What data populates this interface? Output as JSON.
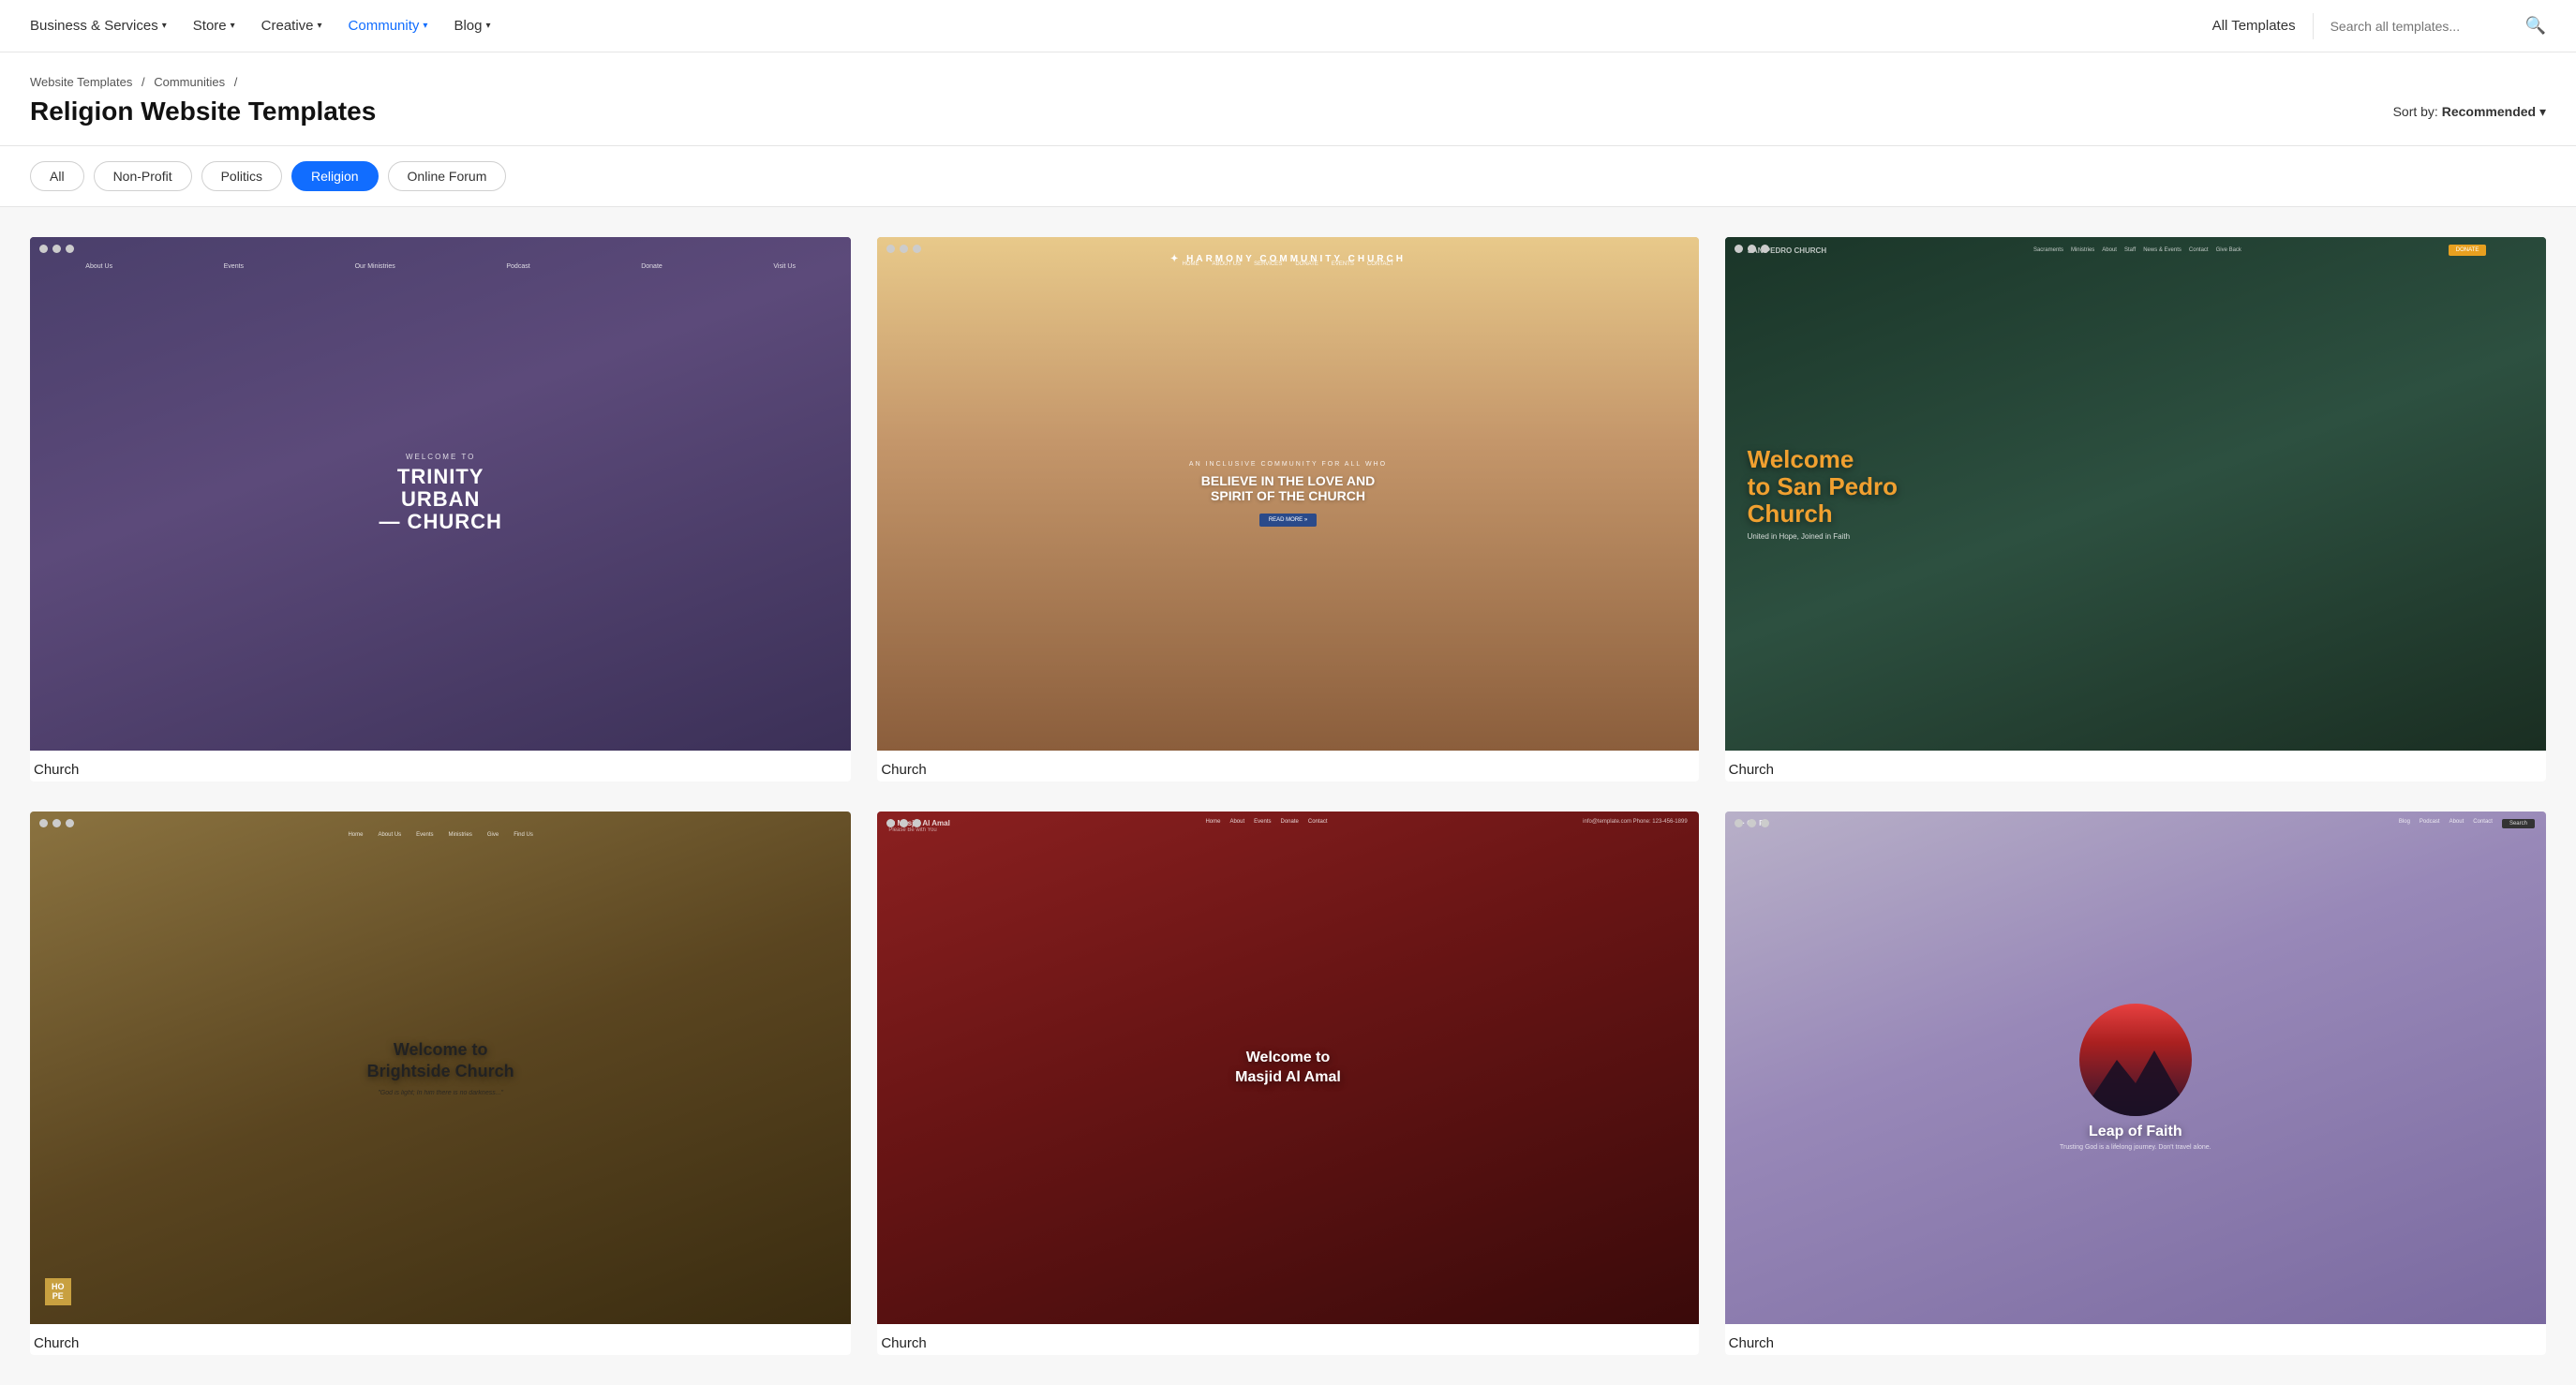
{
  "nav": {
    "items": [
      {
        "id": "business-services",
        "label": "Business & Services",
        "hasDropdown": true,
        "active": false
      },
      {
        "id": "store",
        "label": "Store",
        "hasDropdown": true,
        "active": false
      },
      {
        "id": "creative",
        "label": "Creative",
        "hasDropdown": true,
        "active": false
      },
      {
        "id": "community",
        "label": "Community",
        "hasDropdown": true,
        "active": true
      },
      {
        "id": "blog",
        "label": "Blog",
        "hasDropdown": true,
        "active": false
      }
    ],
    "all_templates": "All Templates",
    "search_placeholder": "Search all templates..."
  },
  "breadcrumb": {
    "parts": [
      "Website Templates",
      "Communities"
    ],
    "separator": "/"
  },
  "page": {
    "title": "Religion Website Templates",
    "sort_label": "Sort by:",
    "sort_value": "Recommended"
  },
  "filters": [
    {
      "id": "all",
      "label": "All",
      "active": false
    },
    {
      "id": "non-profit",
      "label": "Non-Profit",
      "active": false
    },
    {
      "id": "politics",
      "label": "Politics",
      "active": false
    },
    {
      "id": "religion",
      "label": "Religion",
      "active": true
    },
    {
      "id": "online-forum",
      "label": "Online Forum",
      "active": false
    }
  ],
  "templates": [
    {
      "id": "trinity-church",
      "label": "Church",
      "type": "trinity",
      "title": "TRINITY URBAN CHURCH",
      "welcome_text": "WELCOME TO",
      "nav_items": [
        "About Us",
        "Events",
        "Our Ministries",
        "Podcast",
        "Donate",
        "Visit Us"
      ]
    },
    {
      "id": "harmony-church",
      "label": "Church",
      "type": "harmony",
      "logo": "HARMONY COMMUNITY CHURCH",
      "tagline": "AN INCLUSIVE COMMUNITY FOR ALL WHO",
      "title": "BELIEVE IN THE LOVE AND SPIRIT OF THE CHURCH",
      "button": "READ MORE »"
    },
    {
      "id": "sanpedro-church",
      "label": "Church",
      "type": "sanpedro",
      "logo": "SAN PEDRO CHURCH",
      "title": "Welcome to San Pedro Church",
      "subtitle": "United in Hope, Joined in Faith",
      "cta": "DONATE"
    },
    {
      "id": "brightside-church",
      "label": "Church",
      "type": "brightside",
      "title": "Welcome to Brightside Church",
      "quote": "\"God is light; In him there is no darkness...\"",
      "badge": "HO\nPE"
    },
    {
      "id": "masjid-church",
      "label": "Church",
      "type": "masjid",
      "logo": "Masjid Al Amal",
      "tagline": "Please Be with You",
      "title": "Welcome to Masjid Al Amal",
      "contact": "info@template.com  Phone: 123-456-1899"
    },
    {
      "id": "lof-church",
      "label": "Church",
      "type": "lof",
      "nav_items": [
        "Blog",
        "Podcast",
        "About",
        "Contact"
      ],
      "title": "Leap of Faith",
      "subtitle": "Trusting God is a lifelong journey. Don't travel alone."
    }
  ]
}
